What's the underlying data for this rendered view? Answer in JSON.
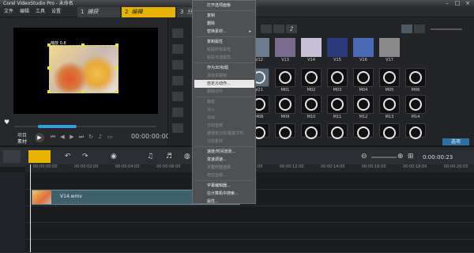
{
  "app": {
    "title": "Corel VideoStudio Pro - 未命名"
  },
  "menu": {
    "file": "文件",
    "edit": "编辑",
    "tools": "工具",
    "settings": "设置"
  },
  "steps": [
    {
      "num": "1",
      "label": "捕获"
    },
    {
      "num": "2",
      "label": "编辑"
    },
    {
      "num": "3",
      "label": "分享"
    }
  ],
  "preview": {
    "clip_label": "缩放 0.8",
    "project_label": "项目",
    "clip_mode_label": "素材",
    "timecode": "00:00:00:00",
    "progress_fraction": 0.27
  },
  "library": {
    "thumbs_row1": [
      "V12",
      "V13",
      "V14",
      "V15",
      "V16",
      "V17"
    ],
    "thumbs_row2": [
      "V21",
      "M01",
      "M02",
      "M03",
      "M04",
      "M05",
      "M06"
    ],
    "thumbs_row3": [
      "M08",
      "M09",
      "M10",
      "M11",
      "M12",
      "M13",
      "M14"
    ],
    "options_tab": "选项"
  },
  "timeline": {
    "timecode": "0:00:00:23",
    "ticks": [
      "00:00:00:00",
      "00:00:02:00",
      "00:00:04:00",
      "00:00:06:00",
      "00:00:08:00",
      "00:00:10:00",
      "00:00:12:00",
      "00:00:14:00",
      "00:00:16:00",
      "00:00:18:00",
      "00:00:20:00"
    ],
    "video_clip_name": "V14.wmv"
  },
  "context_menu": [
    {
      "label": "打开选项面板",
      "enabled": true
    },
    {
      "label": "复制",
      "enabled": true
    },
    {
      "label": "删除",
      "enabled": true
    },
    {
      "label": "替换素材...",
      "enabled": true,
      "submenu": true
    },
    {
      "label": "复制属性",
      "enabled": true
    },
    {
      "label": "粘贴所有属性",
      "enabled": false
    },
    {
      "label": "粘贴可选属性...",
      "enabled": false
    },
    {
      "label": "作为3D标题",
      "enabled": true
    },
    {
      "label": "添加关键帧",
      "enabled": false
    },
    {
      "label": "自定义动作...",
      "enabled": true,
      "highlight": true
    },
    {
      "label": "删除动作",
      "enabled": false
    },
    {
      "label": "静音",
      "enabled": false
    },
    {
      "label": "淡入",
      "enabled": false
    },
    {
      "label": "淡出",
      "enabled": false
    },
    {
      "label": "分割音频",
      "enabled": false
    },
    {
      "label": "按场景分割/提取文件...",
      "enabled": false
    },
    {
      "label": "分割素材",
      "enabled": false
    },
    {
      "label": "速度/时间流逝...",
      "enabled": true
    },
    {
      "label": "变速调速...",
      "enabled": true
    },
    {
      "label": "多重修整视频...",
      "enabled": false
    },
    {
      "label": "修剪音频...",
      "enabled": false
    },
    {
      "label": "字幕编辑器...",
      "enabled": true
    },
    {
      "label": "在计算机中搜索...",
      "enabled": true
    },
    {
      "label": "属性...",
      "enabled": true
    }
  ]
}
